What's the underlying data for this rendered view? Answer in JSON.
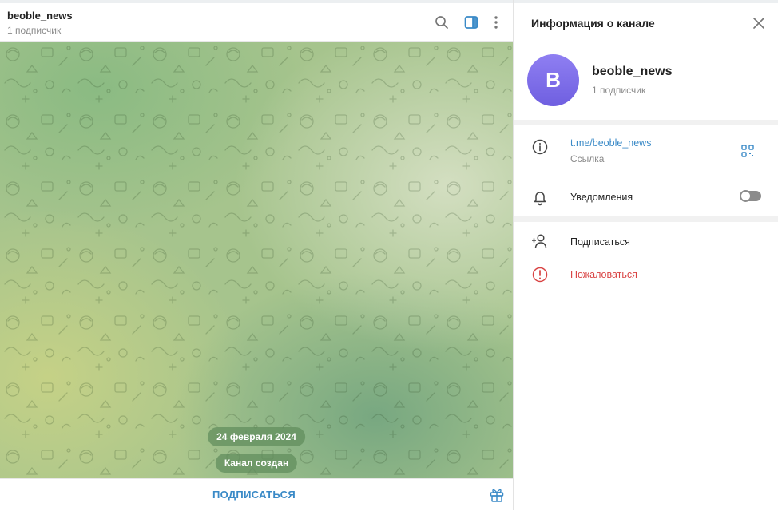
{
  "chat": {
    "title": "beoble_news",
    "subtitle": "1 подписчик",
    "header_icons": [
      "search-icon",
      "sidebar-toggle-icon",
      "more-vertical-icon"
    ],
    "date_label": "24 февраля 2024",
    "service_message": "Канал создан",
    "subscribe_label": "ПОДПИСАТЬСЯ",
    "footer_icon": "gift-icon"
  },
  "panel": {
    "title": "Информация о канале",
    "avatar_letter": "B",
    "channel_name": "beoble_news",
    "channel_subtitle": "1 подписчик",
    "link": "t.me/beoble_news",
    "link_caption": "Ссылка",
    "notifications_label": "Уведомления",
    "notifications_enabled": false,
    "subscribe_label": "Подписаться",
    "report_label": "Пожаловаться"
  },
  "colors": {
    "accent": "#3a8ac7",
    "danger": "#d94444",
    "avatar": "#7b6cf0",
    "pill": "#608c5c"
  }
}
